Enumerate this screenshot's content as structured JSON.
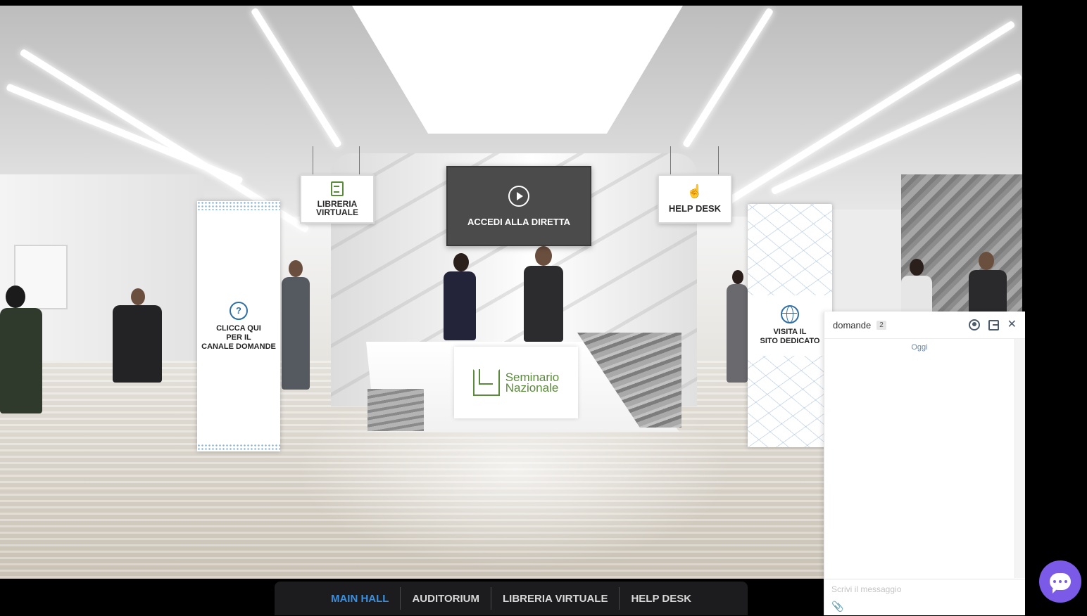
{
  "scene": {
    "sign_libreria": {
      "line1": "LIBRERIA",
      "line2": "VIRTUALE"
    },
    "screen_diretta": "ACCEDI ALLA DIRETTA",
    "sign_help": "HELP DESK",
    "banner_left": {
      "line1": "CLICCA QUI",
      "line2": "PER IL",
      "line3": "CANALE DOMANDE"
    },
    "banner_right": {
      "line1": "VISITA IL",
      "line2": "SITO DEDICATO"
    },
    "desk_logo": {
      "line1": "Seminario",
      "line2": "Nazionale"
    }
  },
  "bottom_nav": {
    "items": [
      {
        "label": "MAIN HALL",
        "active": true
      },
      {
        "label": "AUDITORIUM",
        "active": false
      },
      {
        "label": "LIBRERIA VIRTUALE",
        "active": false
      },
      {
        "label": "HELP DESK",
        "active": false
      }
    ]
  },
  "chat": {
    "title": "domande",
    "badge": "2",
    "date_label": "Oggi",
    "input_placeholder": "Scrivi il messaggio"
  },
  "colors": {
    "nav_active": "#3b8fde",
    "fab": "#7a5ae6",
    "brand_green": "#5a8b3b"
  }
}
